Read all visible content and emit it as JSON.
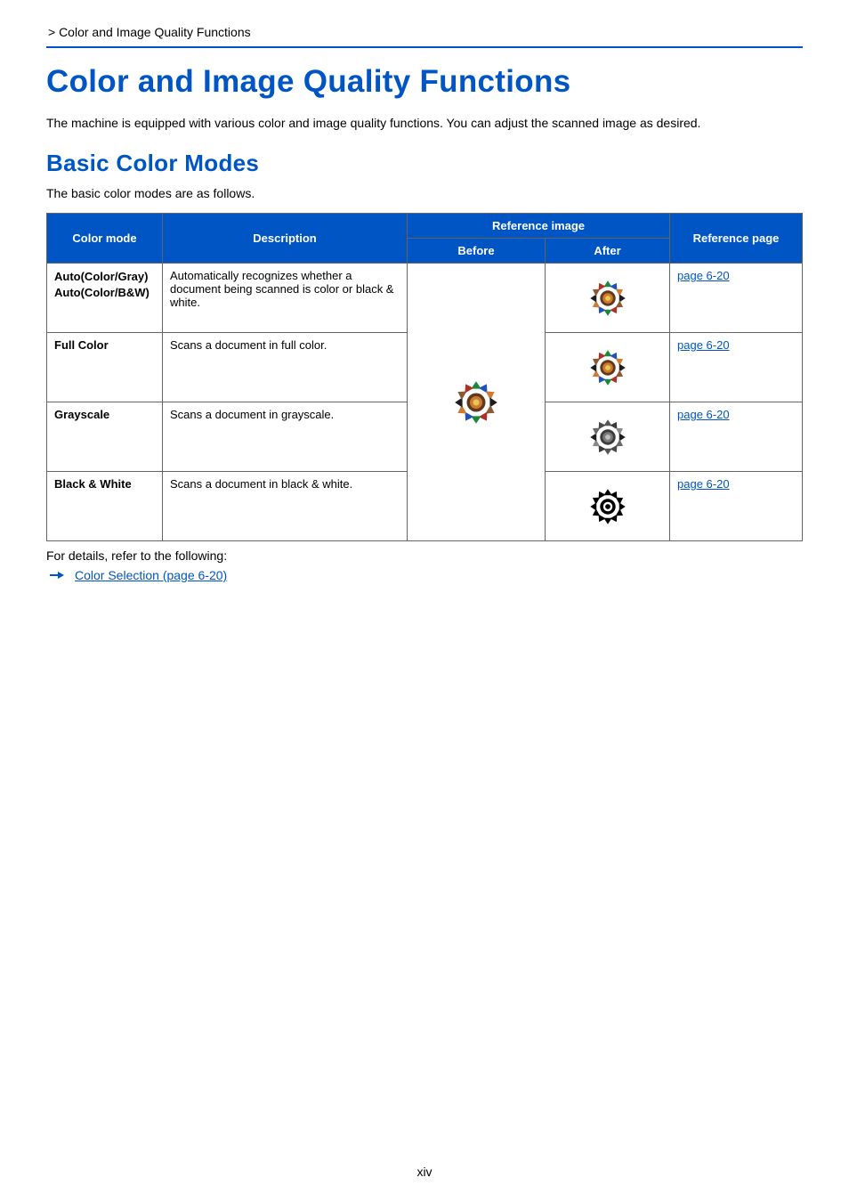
{
  "breadcrumb": " > Color and Image Quality Functions",
  "heading": "Color and Image Quality Functions",
  "intro": "The machine is equipped with various color and image quality functions. You can adjust the scanned image as desired.",
  "sub_heading": "Basic Color Modes",
  "sub_intro": "The basic color modes are as follows.",
  "table": {
    "headers": {
      "mode": "Color mode",
      "desc": "Description",
      "ref_img": "Reference image",
      "before": "Before",
      "after": "After",
      "ref_page": "Reference page"
    },
    "rows": [
      {
        "mode_lines": [
          "Auto(Color/Gray)",
          "Auto(Color/B&W)"
        ],
        "desc": "Automatically recognizes whether a document being scanned is color or black & white.",
        "after_style": "color",
        "ref": "page 6-20"
      },
      {
        "mode_lines": [
          "Full Color"
        ],
        "desc": "Scans a document in full color.",
        "after_style": "color",
        "ref": "page 6-20"
      },
      {
        "mode_lines": [
          "Grayscale"
        ],
        "desc": "Scans a document in grayscale.",
        "after_style": "gray",
        "ref": "page 6-20"
      },
      {
        "mode_lines": [
          "Black & White"
        ],
        "desc": "Scans a document in black & white.",
        "after_style": "bw",
        "ref": "page 6-20"
      }
    ]
  },
  "footnote": "For details, refer to the following:",
  "detail_link": "Color Selection (page 6-20)",
  "page_number": "xiv"
}
